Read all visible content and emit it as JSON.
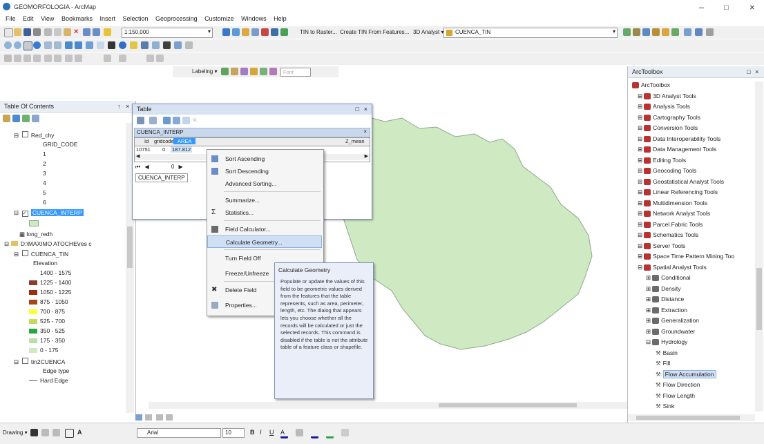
{
  "window": {
    "title": "GEOMORFOLOGIA - ArcMap"
  },
  "menu": [
    "File",
    "Edit",
    "View",
    "Bookmarks",
    "Insert",
    "Selection",
    "Geoprocessing",
    "Customize",
    "Windows",
    "Help"
  ],
  "toolbar": {
    "scale": "1:150,000",
    "tin_to_raster": "TIN to Raster...",
    "create_tin": "Create TIN From Features...",
    "analyst_3d": "3D Analyst ▾",
    "layer_select": "CUENCA_TIN",
    "labeling": "Labeling ▾",
    "font_box": "Font"
  },
  "toc": {
    "title": "Table Of Contents",
    "items": [
      {
        "label": "Red_chy"
      },
      {
        "label": "GRID_CODE"
      },
      {
        "label": "1"
      },
      {
        "label": "2"
      },
      {
        "label": "3"
      },
      {
        "label": "4"
      },
      {
        "label": "5"
      },
      {
        "label": "6"
      },
      {
        "label": "CUENCA_INTERP"
      },
      {
        "label": "long_redh"
      },
      {
        "label": "D:\\MAXIMO ATOCHE\\res c"
      },
      {
        "label": "CUENCA_TIN"
      },
      {
        "label": "Elevation"
      },
      {
        "label": "1400 - 1575"
      },
      {
        "label": "1225 - 1400"
      },
      {
        "label": "1050 - 1225"
      },
      {
        "label": "875 - 1050"
      },
      {
        "label": "700 - 875"
      },
      {
        "label": "525 - 700"
      },
      {
        "label": "350 - 525"
      },
      {
        "label": "175 - 350"
      },
      {
        "label": "0 - 175"
      },
      {
        "label": "tin2CUENCA"
      },
      {
        "label": "Edge type"
      },
      {
        "label": "Hard Edge"
      }
    ],
    "colors": [
      "#ffffff",
      "#8d3b2f",
      "#9a2e10",
      "#a8451b",
      "#ffff33",
      "#f5e14f",
      "#c7d95a",
      "#2aa63f",
      "#b8e0aa",
      "#cfe9c3"
    ]
  },
  "table": {
    "title": "Table",
    "layer_tab": "CUENCA_INTERP",
    "columns": [
      "Id",
      "gridcode",
      "AREA",
      "",
      "Z_mean"
    ],
    "row": [
      "10751",
      "0",
      "187.812"
    ],
    "nav": "0",
    "bottom_tab": "CUENCA_INTERP"
  },
  "context_menu": [
    {
      "label": "Sort Ascending",
      "icon": "sort-ascending-icon"
    },
    {
      "label": "Sort Descending",
      "icon": "sort-descending-icon"
    },
    {
      "label": "Advanced Sorting...",
      "icon": ""
    },
    {
      "label": "Summarize...",
      "icon": ""
    },
    {
      "label": "Statistics...",
      "icon": "sigma-icon"
    },
    {
      "label": "Field Calculator...",
      "icon": "calculator-icon"
    },
    {
      "label": "Calculate Geometry...",
      "icon": ""
    },
    {
      "label": "Turn Field Off",
      "icon": ""
    },
    {
      "label": "Freeze/Unfreeze",
      "icon": ""
    },
    {
      "label": "Delete Field",
      "icon": "delete-icon"
    },
    {
      "label": "Properties...",
      "icon": "properties-icon"
    }
  ],
  "tooltip": {
    "title": "Calculate Geometry",
    "body": "Populate or update the values of this field to be geometric values derived from the features that the table represents, such as area, perimeter, length, etc. The dialog that appears lets you choose whether all the records will be calculated or just the selected records. This command is disabled if the table is not the attribute table of a feature class or shapefile."
  },
  "toolbox": {
    "title": "ArcToolbox",
    "items": [
      {
        "label": "ArcToolbox",
        "level": 0
      },
      {
        "label": "3D Analyst Tools",
        "level": 1
      },
      {
        "label": "Analysis Tools",
        "level": 1
      },
      {
        "label": "Cartography Tools",
        "level": 1
      },
      {
        "label": "Conversion Tools",
        "level": 1
      },
      {
        "label": "Data Interoperability Tools",
        "level": 1
      },
      {
        "label": "Data Management Tools",
        "level": 1
      },
      {
        "label": "Editing Tools",
        "level": 1
      },
      {
        "label": "Geocoding Tools",
        "level": 1
      },
      {
        "label": "Geostatistical Analyst Tools",
        "level": 1
      },
      {
        "label": "Linear Referencing Tools",
        "level": 1
      },
      {
        "label": "Multidimension Tools",
        "level": 1
      },
      {
        "label": "Network Analyst Tools",
        "level": 1
      },
      {
        "label": "Parcel Fabric Tools",
        "level": 1
      },
      {
        "label": "Schematics Tools",
        "level": 1
      },
      {
        "label": "Server Tools",
        "level": 1
      },
      {
        "label": "Space Time Pattern Mining Too",
        "level": 1
      },
      {
        "label": "Spatial Analyst Tools",
        "level": 1
      },
      {
        "label": "Conditional",
        "level": 2
      },
      {
        "label": "Density",
        "level": 2
      },
      {
        "label": "Distance",
        "level": 2
      },
      {
        "label": "Extraction",
        "level": 2
      },
      {
        "label": "Generalization",
        "level": 2
      },
      {
        "label": "Groundwater",
        "level": 2
      },
      {
        "label": "Hydrology",
        "level": 2
      },
      {
        "label": "Basin",
        "level": 3
      },
      {
        "label": "Fill",
        "level": 3
      },
      {
        "label": "Flow Accumulation",
        "level": 3
      },
      {
        "label": "Flow Direction",
        "level": 3
      },
      {
        "label": "Flow Length",
        "level": 3
      },
      {
        "label": "Sink",
        "level": 3
      }
    ]
  },
  "drawing": {
    "label": "Drawing ▾",
    "font": "Arial",
    "size": "10"
  },
  "colors": {
    "basin_fill": "#cfe9c3",
    "basin_stroke": "#8aa98b",
    "selection": "#3399ff",
    "tooltip_bg": "#e9eef8"
  }
}
